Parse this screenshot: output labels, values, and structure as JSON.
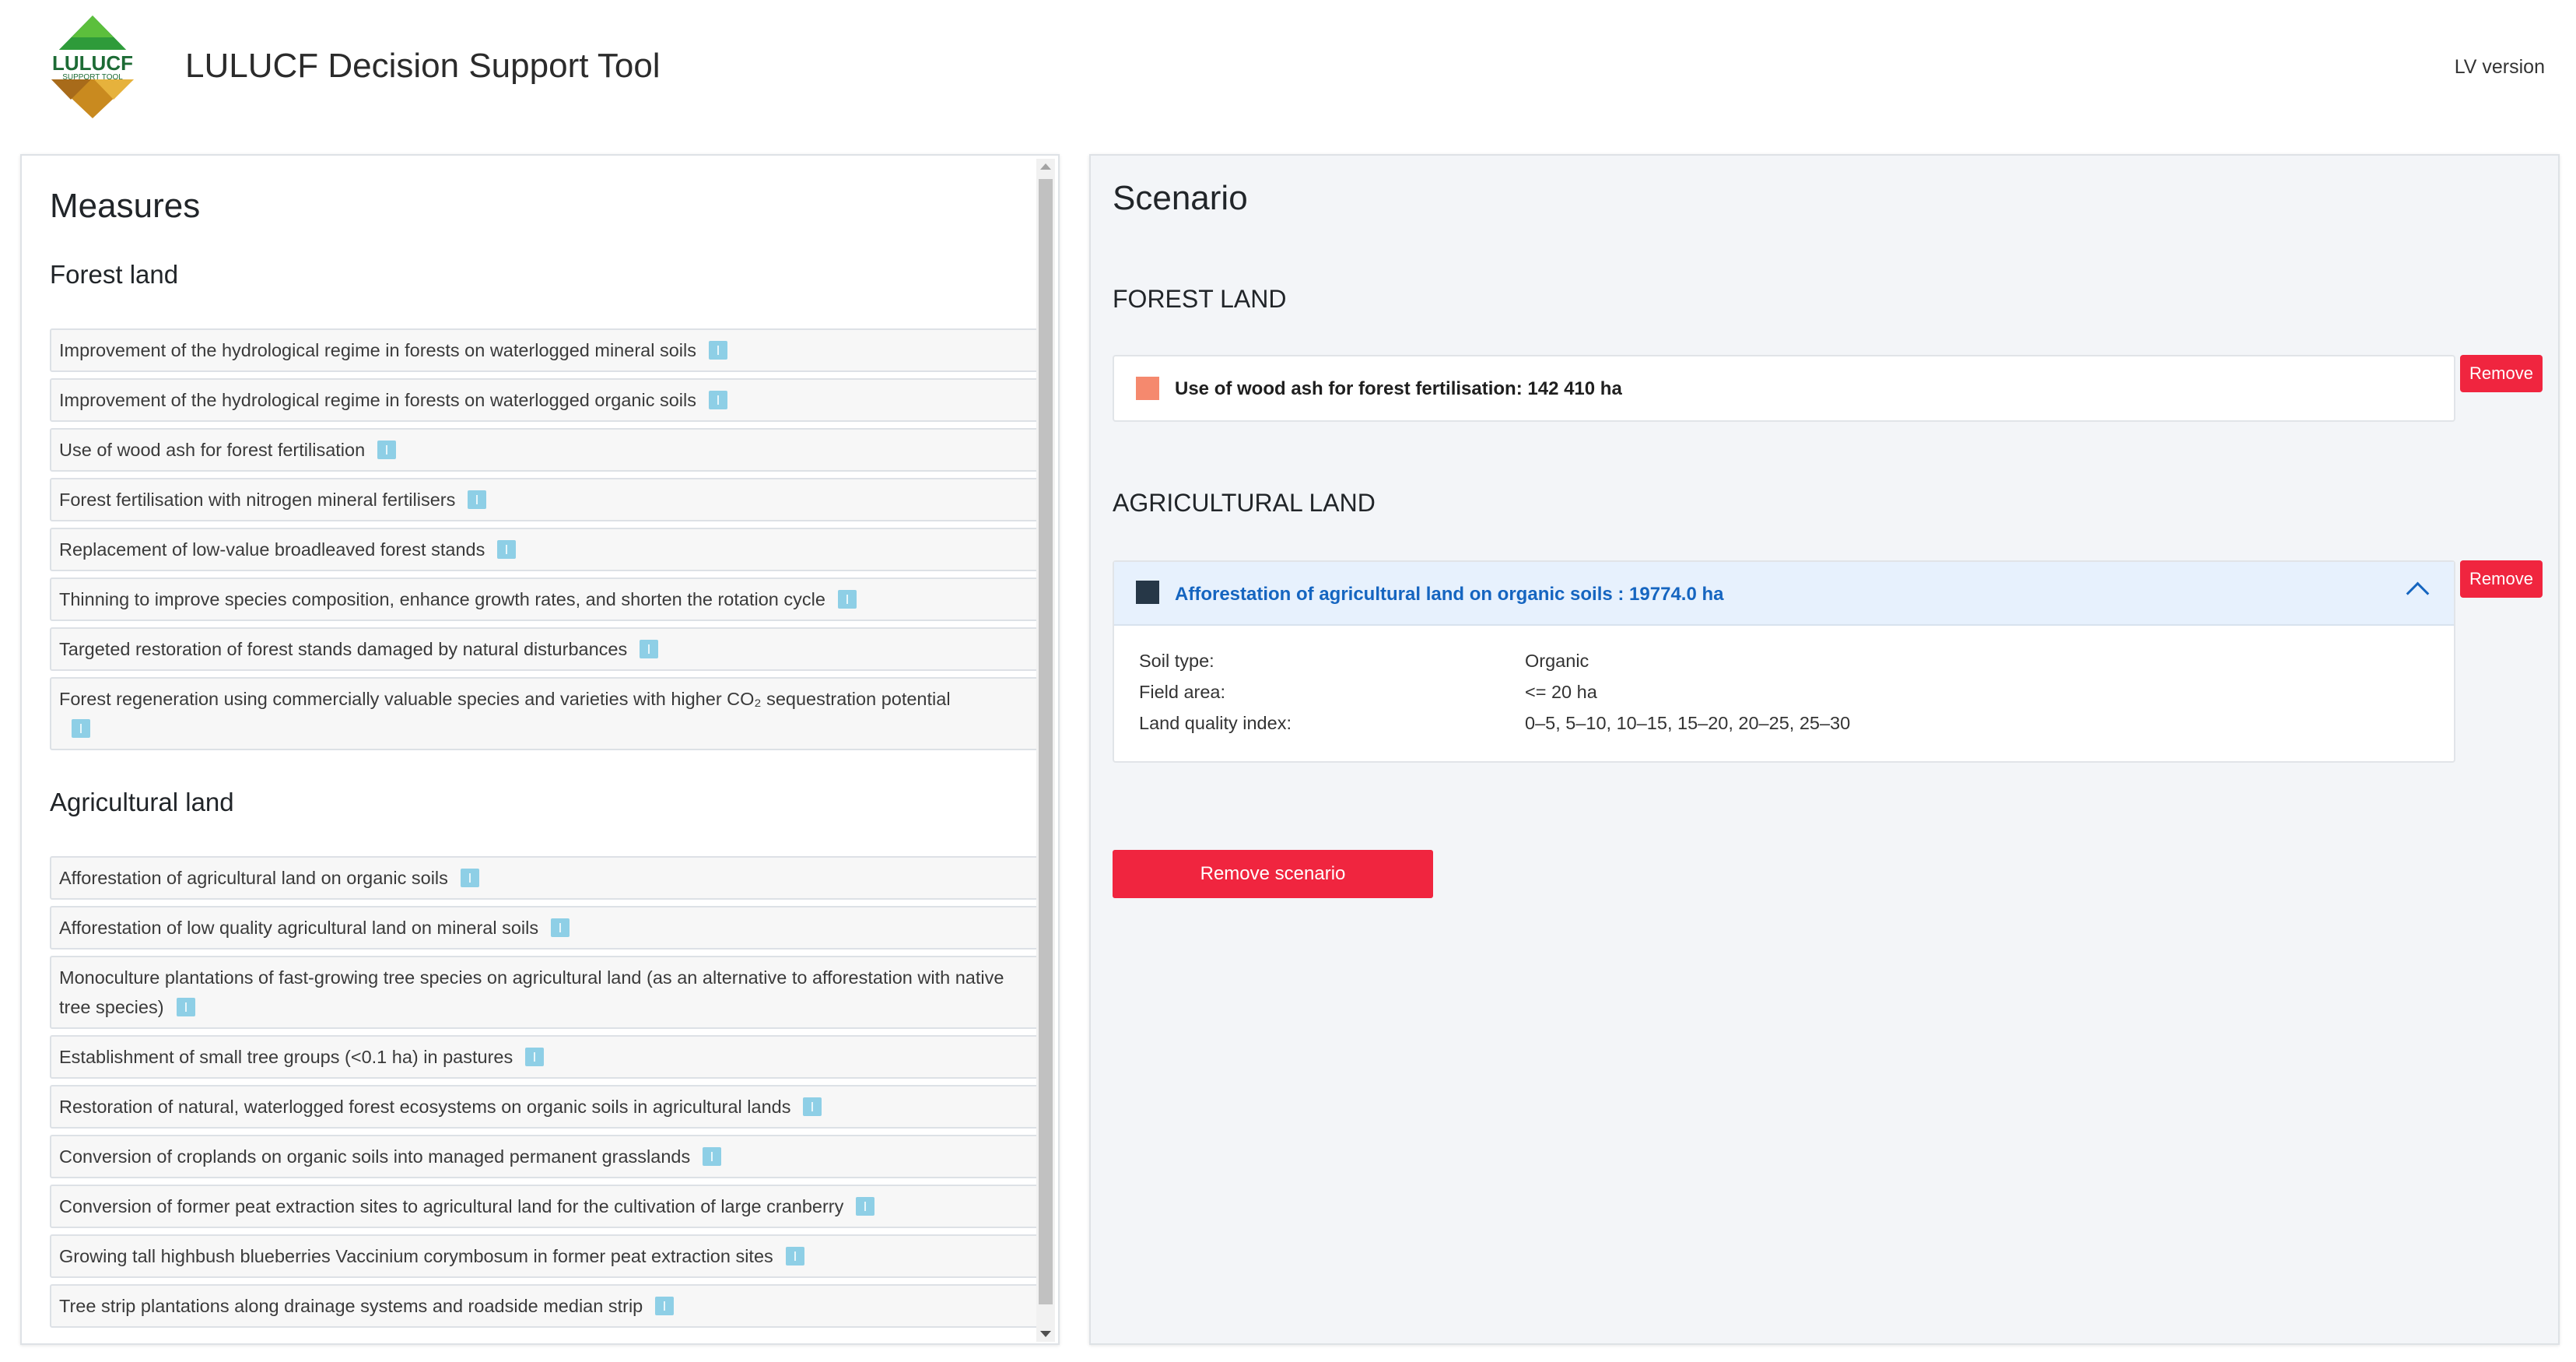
{
  "header": {
    "logo_text": "LULUCF",
    "logo_subtext": "SUPPORT TOOL",
    "title": "LULUCF Decision Support Tool",
    "language_link": "LV version"
  },
  "measures": {
    "title": "Measures",
    "forest": {
      "title": "Forest land",
      "items": [
        {
          "label": "Improvement of the hydrological regime in forests on waterlogged mineral soils"
        },
        {
          "label": "Improvement of the hydrological regime in forests on waterlogged organic soils"
        },
        {
          "label": "Use of wood ash for forest fertilisation"
        },
        {
          "label": "Forest fertilisation with nitrogen mineral fertilisers"
        },
        {
          "label": "Replacement of low-value broadleaved forest stands"
        },
        {
          "label": "Thinning to improve species composition, enhance growth rates, and shorten the rotation cycle"
        },
        {
          "label": "Targeted restoration of forest stands damaged by natural disturbances"
        },
        {
          "label": "Forest regeneration using commercially valuable species and varieties with higher CO₂ sequestration potential"
        }
      ]
    },
    "agricultural": {
      "title": "Agricultural land",
      "items": [
        {
          "label": "Afforestation of agricultural land on organic soils"
        },
        {
          "label": "Afforestation of low quality agricultural land on mineral soils"
        },
        {
          "label": "Monoculture plantations of fast-growing tree species on agricultural land (as an alternative to afforestation with native tree species)"
        },
        {
          "label": "Establishment of small tree groups (<0.1 ha) in pastures"
        },
        {
          "label": "Restoration of natural, waterlogged forest ecosystems on organic soils in agricultural lands"
        },
        {
          "label": "Conversion of croplands on organic soils into managed permanent grasslands"
        },
        {
          "label": "Conversion of former peat extraction sites to agricultural land for the cultivation of large cranberry"
        },
        {
          "label": "Growing tall highbush blueberries Vaccinium corymbosum in former peat extraction sites"
        },
        {
          "label": "Tree strip plantations along drainage systems and roadside median strip"
        }
      ]
    }
  },
  "scenario": {
    "title": "Scenario",
    "forest_section": {
      "title": "FOREST LAND",
      "item": {
        "label": "Use of wood ash for forest fertilisation: 142 410 ha",
        "color": "#f5896e"
      },
      "remove_label": "Remove"
    },
    "agri_section": {
      "title": "AGRICULTURAL LAND",
      "item": {
        "label": "Afforestation of agricultural land on organic soils : 19774.0 ha",
        "color": "#263747",
        "link_color": "#1565c0"
      },
      "details": [
        {
          "key": "Soil type:",
          "value": "Organic"
        },
        {
          "key": "Field area:",
          "value": "<= 20 ha"
        },
        {
          "key": "Land quality index:",
          "value": "0–5, 5–10, 10–15, 15–20, 20–25, 25–30"
        }
      ],
      "remove_label": "Remove"
    },
    "remove_scenario_label": "Remove scenario"
  },
  "colors": {
    "danger": "#f0253f",
    "info_badge": "#8ecfe6",
    "panel_bg": "#f3f5f8",
    "accordion_bg": "#e7f1fd"
  }
}
